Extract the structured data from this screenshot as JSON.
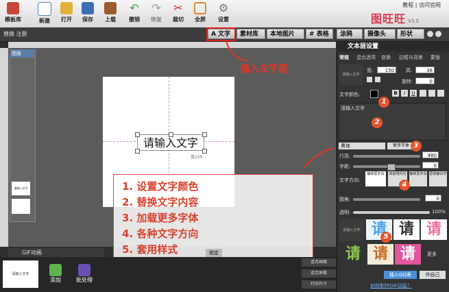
{
  "toolbar": {
    "items": [
      {
        "label": "模板库",
        "icon": "template-house-icon",
        "color": "#c9453a"
      },
      {
        "label": "新建",
        "icon": "new-document-icon",
        "color": "#4f86c6"
      },
      {
        "label": "打开",
        "icon": "open-folder-icon",
        "color": "#e2b13c"
      },
      {
        "label": "保存",
        "icon": "save-disk-icon",
        "color": "#3b6fb6"
      },
      {
        "label": "上载",
        "icon": "upload-box-icon",
        "color": "#9a5b2e"
      },
      {
        "label": "撤销",
        "icon": "undo-arrow-icon",
        "color": "#4aa34a"
      },
      {
        "label": "恢复",
        "icon": "redo-arrow-icon",
        "color": "#9c9c9c"
      },
      {
        "label": "裁切",
        "icon": "scissors-icon",
        "color": "#c8302c"
      },
      {
        "label": "全屏",
        "icon": "fullscreen-icon",
        "color": "#e08a2b"
      },
      {
        "label": "设置",
        "icon": "settings-gear-icon",
        "color": "#777777"
      }
    ],
    "brand": {
      "links": "教程 | 访问官网",
      "logo": "图旺旺",
      "version": "V3.5"
    }
  },
  "subbar": {
    "left": "替换 注册",
    "buttons": [
      "文字",
      "素材库",
      "本地图片",
      "表格",
      "涂鸦",
      "摄像头",
      "形状"
    ]
  },
  "canvas": {
    "layers_title": "图层",
    "layer_thumb_label": "请输入文字",
    "text_value": "请输入文字",
    "size_hint": "宽150"
  },
  "annotation_top": "插入文字层",
  "annotations": [
    "1. 设置文字颜色",
    "2. 替换文字内容",
    "3. 加载更多字体",
    "4. 各种文字方向",
    "5. 套用样式"
  ],
  "right_panel": {
    "title": "文本层设置",
    "tabs": [
      "常规",
      "混合选项",
      "变换",
      "边框与背景",
      "蒙版"
    ],
    "preview_label": "请输入文字",
    "width_label": "宽:",
    "width_value": "150",
    "height_label": "高:",
    "height_value": "38",
    "rotate_label": "旋转:",
    "rotate_value": "0",
    "color_label": "文字颜色:",
    "format_buttons": [
      "B",
      "I",
      "U"
    ],
    "text_input": "请输入文字",
    "font_select": "黑体",
    "more_fonts": "更多字体",
    "line_height_label": "行高:",
    "line_height_value": "480",
    "spacing_label": "字距:",
    "spacing_value": "0",
    "direction_label": "文字方向:",
    "direction_options": [
      "静夜思字白",
      "床前明月光",
      "静夜思字白",
      "思夜静白字"
    ],
    "radius_label": "圆角:",
    "radius_value": "0",
    "opacity_label": "透明:",
    "opacity_value": "100%",
    "style_preview": "请输入文字",
    "style_char": "请",
    "more_label": "更多",
    "qq_button": "插入QQ表",
    "self_label": "作自己",
    "help_link": "如何制作GIF动画？"
  },
  "bottom": {
    "gif_label": "GIF动画",
    "add_label": "添加",
    "batch_label": "批处理",
    "lock_label": "锁定",
    "right_buttons": [
      "适合画面",
      "适合屏幕",
      "打印尺寸"
    ],
    "thumb_label": "请输入文字"
  },
  "numbers": [
    "1",
    "2",
    "3",
    "4",
    "5"
  ]
}
